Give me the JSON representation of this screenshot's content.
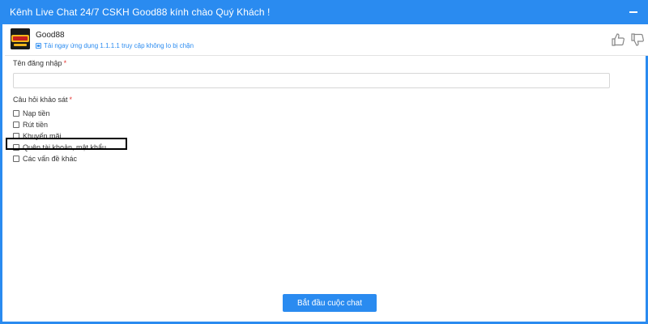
{
  "window": {
    "title": "Kênh Live Chat 24/7 CSKH Good88 kính chào Quý Khách !"
  },
  "header": {
    "brand_name": "Good88",
    "subtitle": "Tải ngay ứng dụng 1.1.1.1 truy cập không lo bị chặn",
    "icons": [
      "phone-icon",
      "thumbs-up-icon",
      "thumbs-down-icon",
      "minimize-icon"
    ]
  },
  "form": {
    "username_label": "Tên đăng nhập",
    "required_mark": "*",
    "username_value": "",
    "survey_label": "Câu hỏi khảo sát",
    "options": [
      {
        "label": "Nạp tiền",
        "checked": false
      },
      {
        "label": "Rút tiền",
        "checked": false
      },
      {
        "label": "Khuyến mãi",
        "checked": false
      },
      {
        "label": "Quên tài khoản, mật khẩu",
        "checked": false
      },
      {
        "label": "Các vấn đề khác",
        "checked": false
      }
    ]
  },
  "actions": {
    "start_chat": "Bắt đầu cuộc chat"
  },
  "colors": {
    "accent": "#2a8bf0",
    "required": "#e53935",
    "highlight_border": "#000000"
  }
}
